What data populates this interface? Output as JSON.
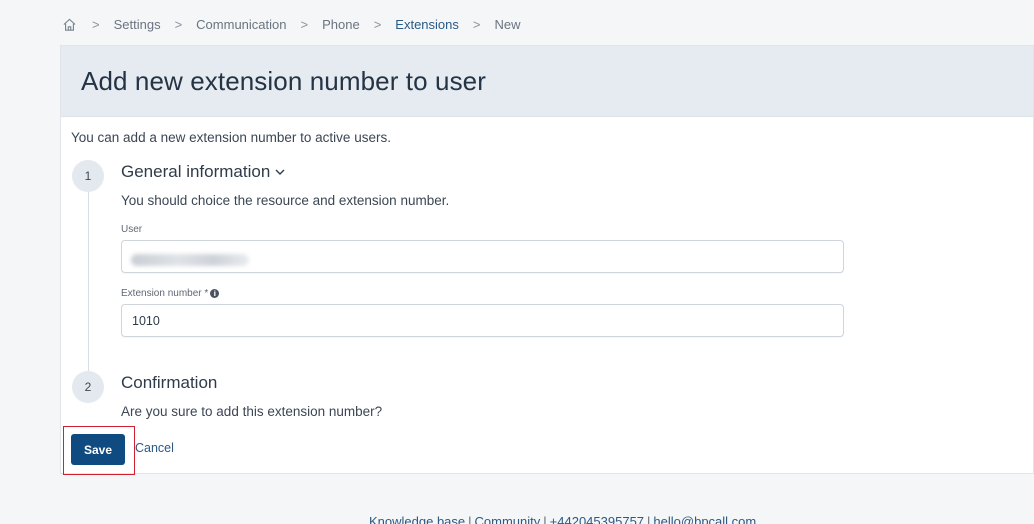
{
  "breadcrumb": {
    "home_icon": "home-icon",
    "items": [
      "Settings",
      "Communication",
      "Phone",
      "Extensions",
      "New"
    ]
  },
  "page": {
    "title": "Add new extension number to user",
    "intro": "You can add a new extension number to active users."
  },
  "steps": [
    {
      "number": "1",
      "title": "General information",
      "description": "You should choice the resource and extension number."
    },
    {
      "number": "2",
      "title": "Confirmation",
      "description": "Are you sure to add this extension number?"
    }
  ],
  "form": {
    "user_label": "User",
    "user_value": "",
    "extension_label": "Extension number *",
    "extension_value": "1010"
  },
  "actions": {
    "save_label": "Save",
    "cancel_label": "Cancel"
  },
  "footer": {
    "links": [
      "Knowledge base",
      "Community",
      "+442045395757",
      "hello@bpcall.com"
    ]
  },
  "colors": {
    "primary": "#0f4a80",
    "link": "#2a5a85",
    "header_bg": "#e6ebf1",
    "highlight": "#d1202f"
  }
}
